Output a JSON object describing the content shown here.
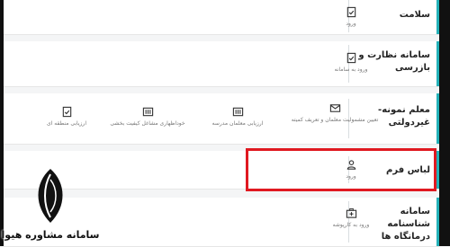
{
  "services": [
    {
      "title": "سلامت",
      "items": [
        {
          "label": "ورود",
          "icon": "document-check-icon"
        }
      ]
    },
    {
      "title": "سامانه نظارت و بازرسی",
      "items": [
        {
          "label": "ورود به سامانه",
          "icon": "document-check-icon"
        }
      ]
    },
    {
      "title": "معلم نمونه-غیردولتی",
      "items": [
        {
          "label": "تعیین مشمولیت معلمان و تعریف کمیته",
          "icon": "mail-icon"
        },
        {
          "label": "ارزیابی معلمان مدرسه",
          "icon": "checklist-icon"
        },
        {
          "label": "خوداظهاری مشاغل کیفیت بخشی",
          "icon": "checklist-icon"
        },
        {
          "label": "ارزیابی منطقه ای",
          "icon": "document-check-icon"
        }
      ]
    },
    {
      "title": "لباس فرم",
      "items": [
        {
          "label": "ورود",
          "icon": "user-icon"
        }
      ]
    },
    {
      "title": "سامانه شناسنامه درمانگاه ها",
      "items": [
        {
          "label": "ورود به کارپوشه",
          "icon": "medical-kit-icon"
        }
      ]
    }
  ],
  "watermark": {
    "text": "سامانه مشاوره هیوا"
  },
  "colors": {
    "accent": "#23b1b8",
    "highlight": "#e01921"
  }
}
